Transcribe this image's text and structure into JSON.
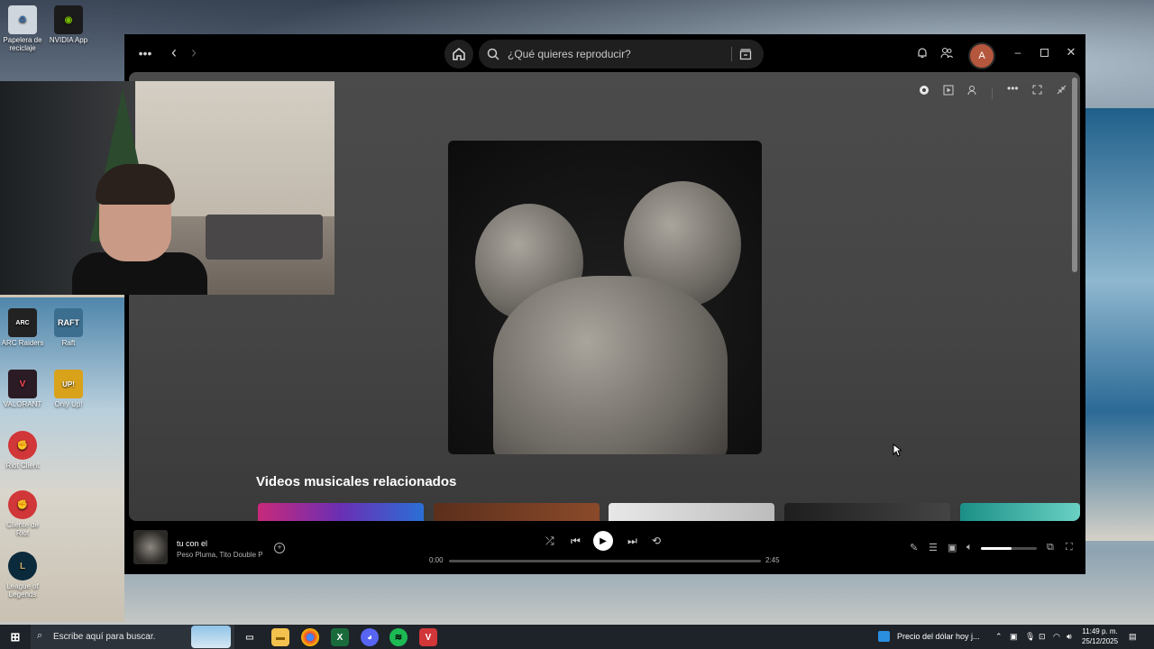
{
  "desktop": {
    "icons": [
      {
        "label": "Papelera de reciclaje"
      },
      {
        "label": "NVIDIA App"
      },
      {
        "label": "ARC Raiders"
      },
      {
        "label": "Raft"
      },
      {
        "label": "VALORANT"
      },
      {
        "label": "Only Up!"
      },
      {
        "label": "Riot Client"
      },
      {
        "label": "Cliente de Riot"
      },
      {
        "label": "League of Legends"
      }
    ]
  },
  "spotify": {
    "search_placeholder": "¿Qué quieres reproducir?",
    "avatar_initial": "A",
    "section_title": "Videos musicales relacionados",
    "player": {
      "track_title": "tu con el",
      "track_artist": "Peso Pluma, Tito Double P",
      "time_elapsed": "0:00",
      "time_total": "2:45",
      "progress": 0.0,
      "volume": 0.55
    }
  },
  "taskbar": {
    "search_placeholder": "Escribe aquí para buscar.",
    "news_widget": "Precio del dólar hoy j...",
    "time": "11:49 p. m.",
    "date": "25/12/2025"
  },
  "colors": {
    "spotify_bg": "#000000",
    "accent_avatar": "#b4573d",
    "spotify_green": "#1db954"
  }
}
